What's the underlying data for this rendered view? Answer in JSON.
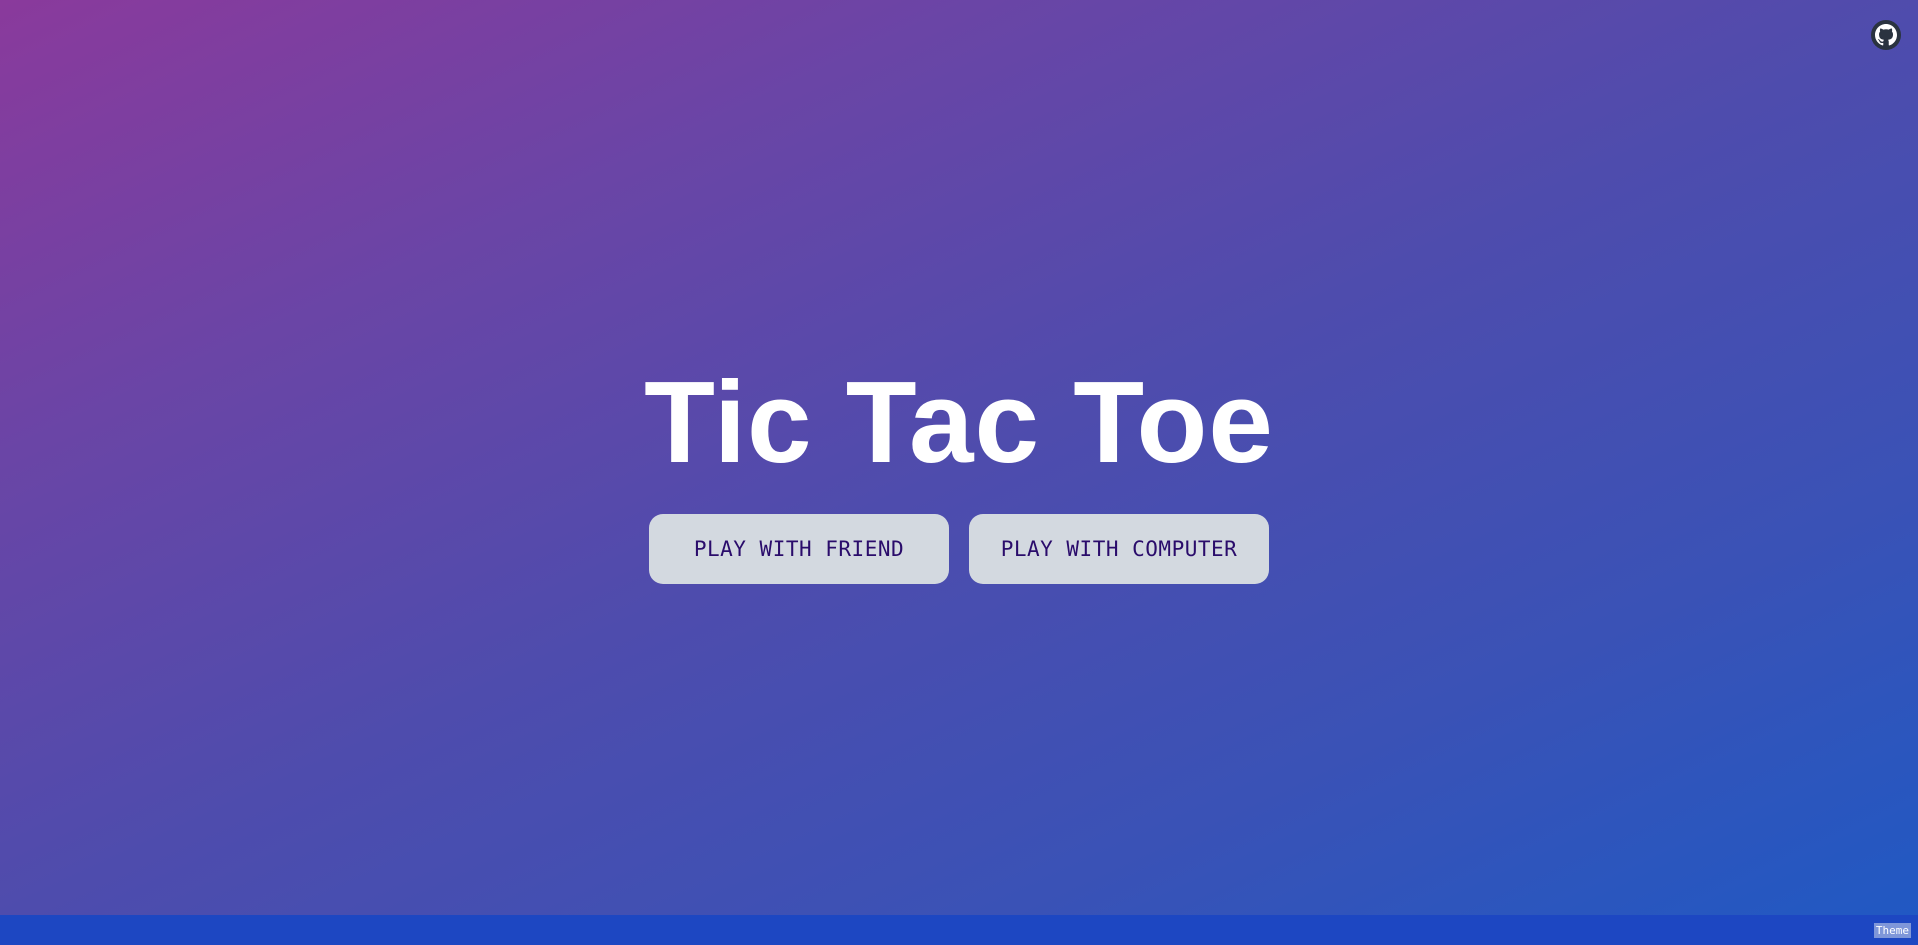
{
  "header": {
    "github_icon": "github-icon"
  },
  "hero": {
    "title": "Tic Tac Toe"
  },
  "modes": {
    "friend_label": "PLAY WITH FRIEND",
    "computer_label": "PLAY WITH COMPUTER"
  },
  "footer": {
    "theme_label": "Theme"
  },
  "colors": {
    "gradient_start": "#8a3a9c",
    "gradient_end": "#1f59c4",
    "button_bg": "#d3d9e0",
    "button_text": "#2a0c6b",
    "footer_bg": "#1d47c2"
  }
}
